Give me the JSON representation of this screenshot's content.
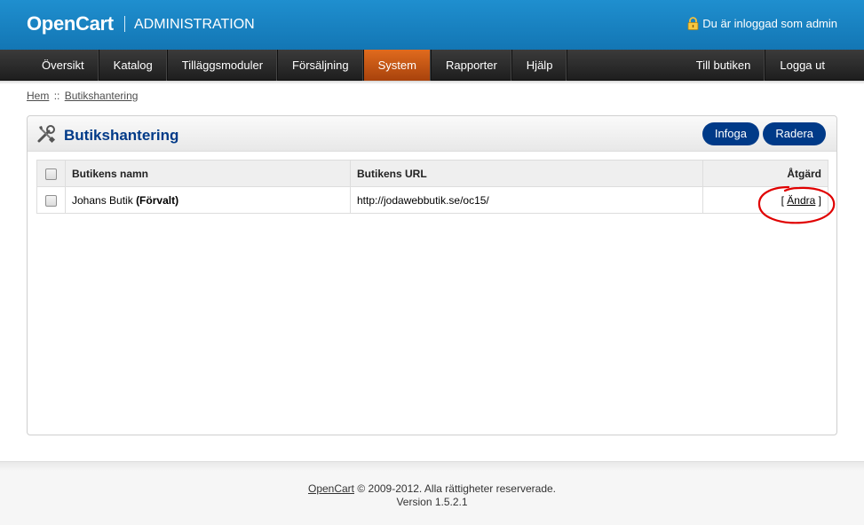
{
  "header": {
    "logo": "OpenCart",
    "title": "ADMINISTRATION",
    "logged_in": "Du är inloggad som admin"
  },
  "menu": {
    "left": [
      "Översikt",
      "Katalog",
      "Tilläggsmoduler",
      "Försäljning",
      "System",
      "Rapporter",
      "Hjälp"
    ],
    "right": [
      "Till butiken",
      "Logga ut"
    ],
    "active": "System"
  },
  "breadcrumb": {
    "home": "Hem",
    "separator": "::",
    "current": "Butikshantering"
  },
  "box": {
    "title": "Butikshantering",
    "insert_label": "Infoga",
    "delete_label": "Radera"
  },
  "table": {
    "headers": {
      "name": "Butikens namn",
      "url": "Butikens URL",
      "action": "Åtgärd"
    },
    "rows": [
      {
        "name": "Johans Butik",
        "default_tag": "(Förvalt)",
        "url": "http://jodawebbutik.se/oc15/",
        "action_open": "[",
        "action_link": "Ändra",
        "action_close": "]"
      }
    ]
  },
  "footer": {
    "link": "OpenCart",
    "copyright": "© 2009-2012. Alla rättigheter reserverade.",
    "version": "Version 1.5.2.1"
  },
  "colors": {
    "header_blue": "#1783c3",
    "menu_active": "#c9581a",
    "title_blue": "#003a88",
    "annotation_red": "#e00000"
  }
}
